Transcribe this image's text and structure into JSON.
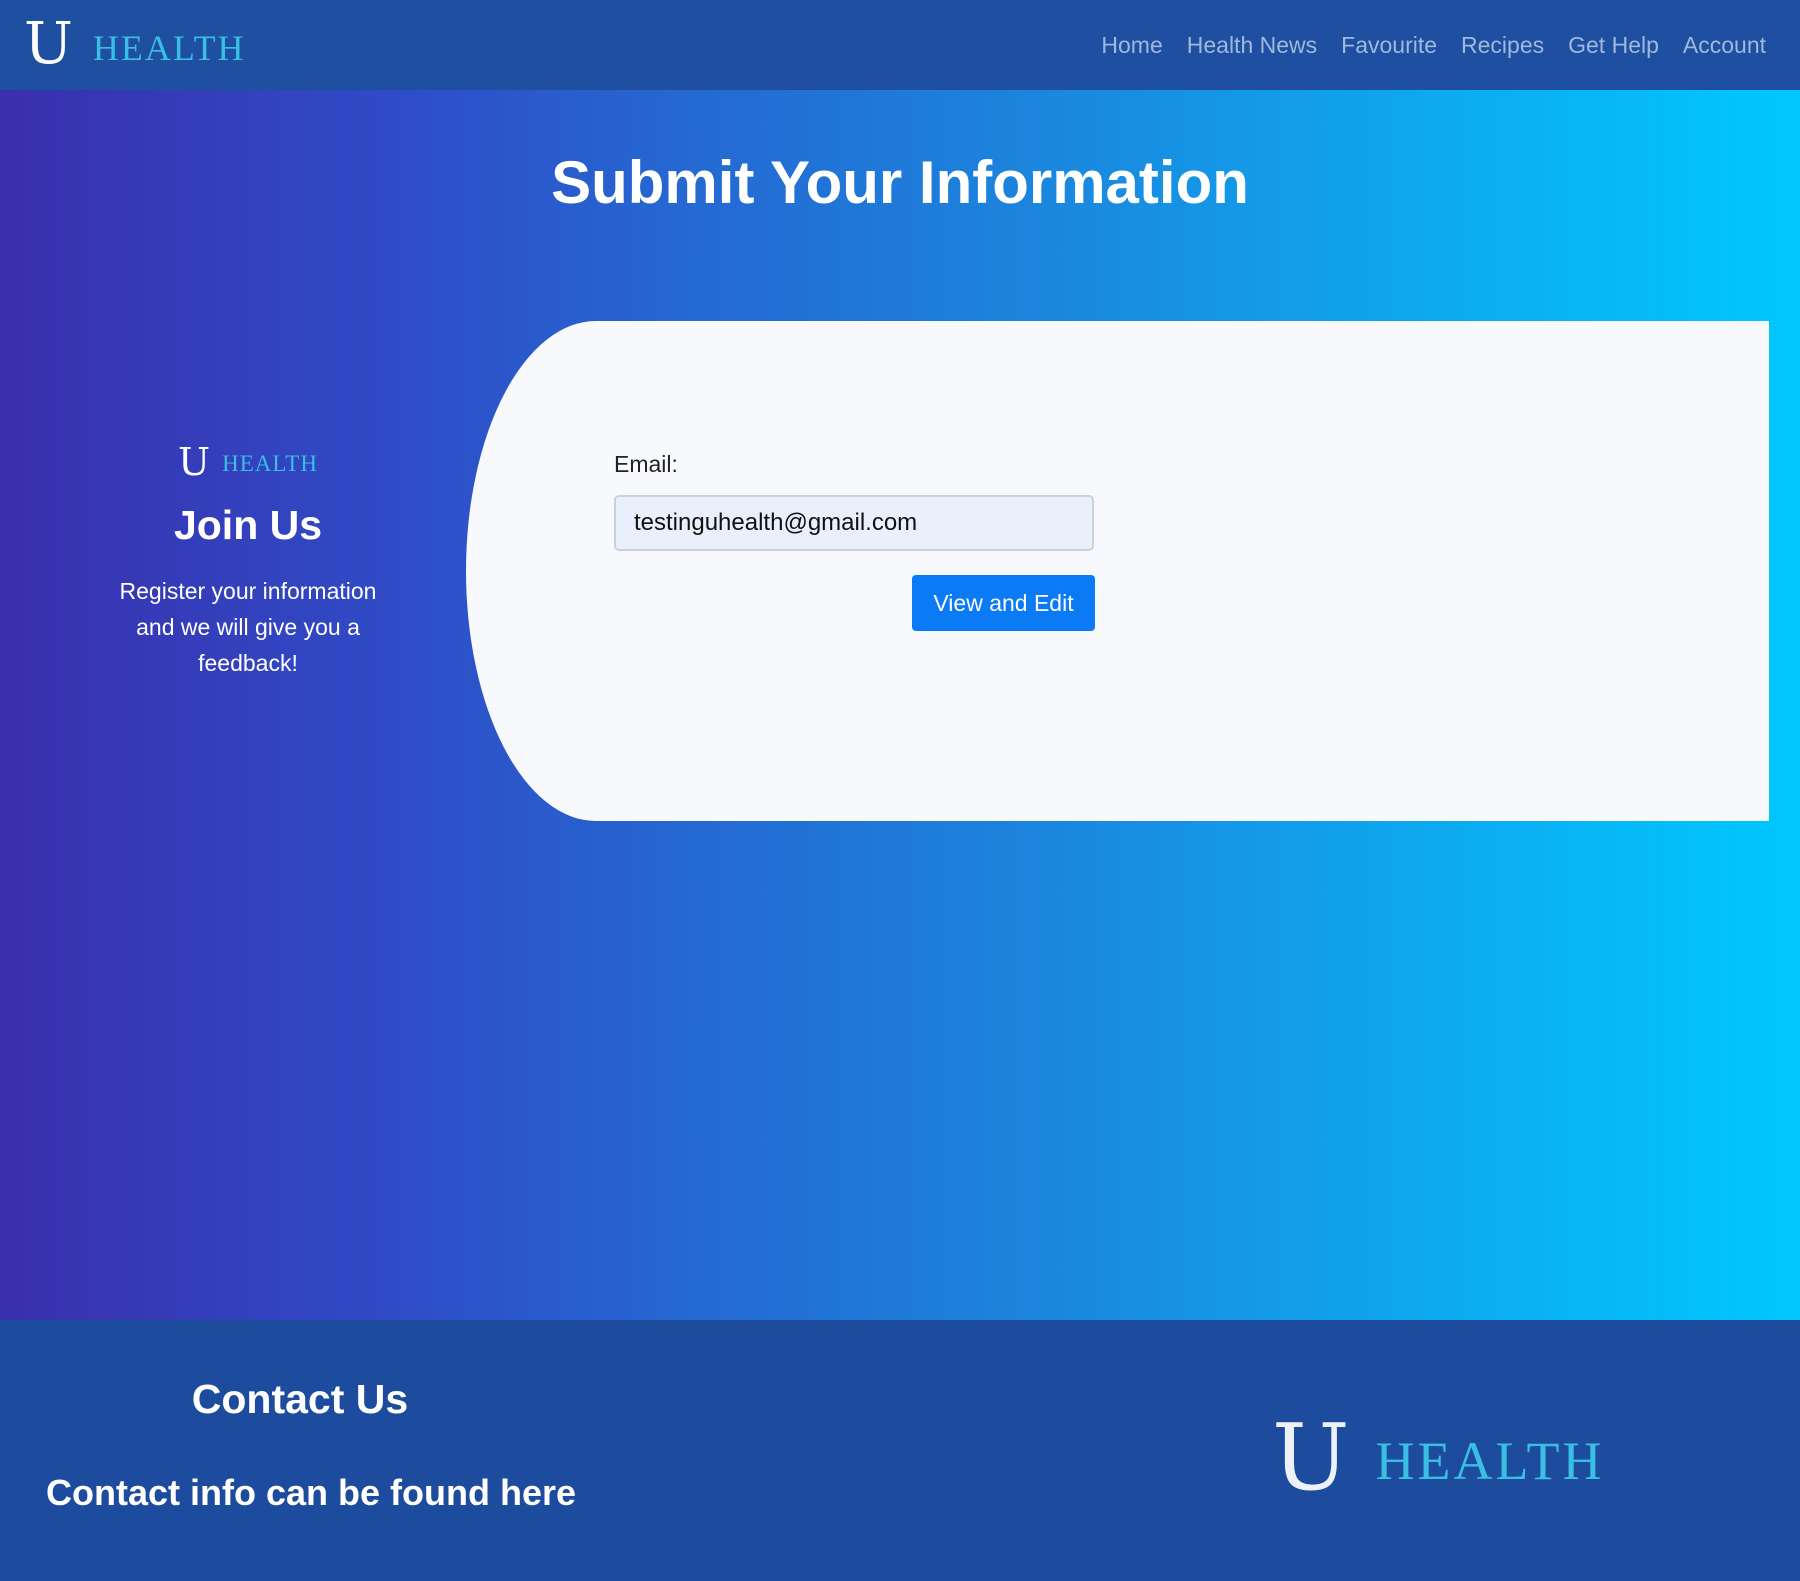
{
  "nav": {
    "brand_mark": "U",
    "brand_word": "HEALTH",
    "links": [
      "Home",
      "Health News",
      "Favourite",
      "Recipes",
      "Get Help",
      "Account"
    ]
  },
  "hero": {
    "title": "Submit Your Information"
  },
  "join": {
    "brand_mark": "U",
    "brand_word": "HEALTH",
    "title": "Join Us",
    "text": "Register your information and we will give you a feedback!"
  },
  "form": {
    "email_label": "Email:",
    "email_value": "testinguhealth@gmail.com",
    "submit_label": "View and Edit"
  },
  "footer": {
    "contact_title": "Contact Us",
    "contact_text": "Contact info can be found here",
    "brand_mark": "U",
    "brand_word": "HEALTH"
  },
  "colors": {
    "navbar": "#1e4fa0",
    "brand_accent": "#39bfe2",
    "button": "#0a7bf4",
    "gradient_start": "#3a2fae",
    "gradient_end": "#00c8ff"
  }
}
